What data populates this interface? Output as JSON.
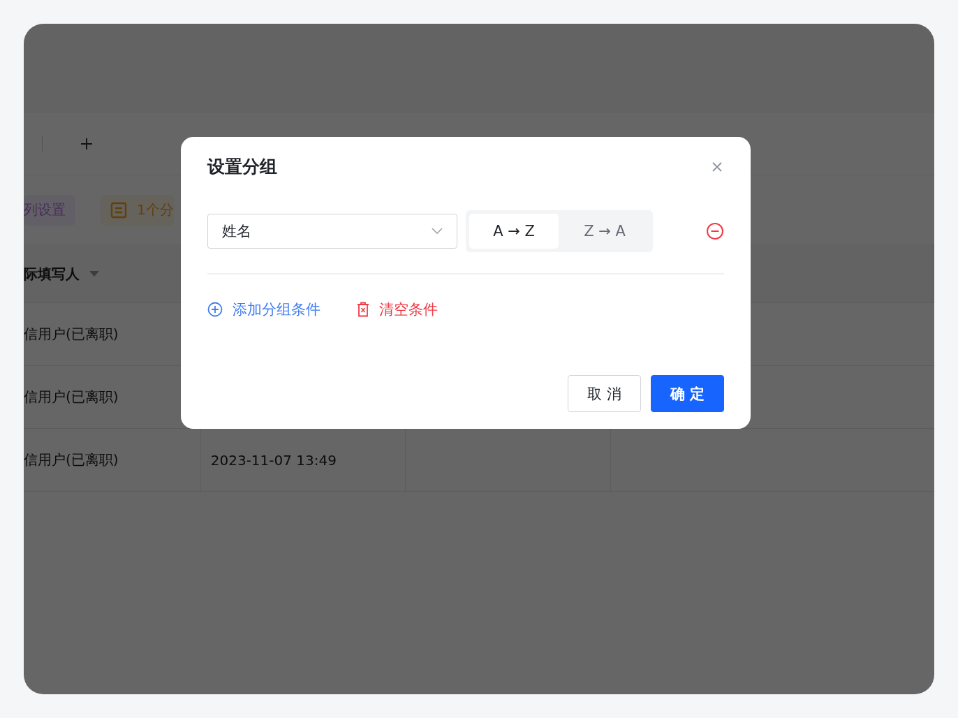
{
  "page": {
    "toolbar": [
      {
        "label": "列设置",
        "kind": "columns"
      },
      {
        "label": "1个分",
        "kind": "group"
      }
    ],
    "table": {
      "columns": [
        "际填写人"
      ],
      "rows": [
        {
          "cells": [
            "信用户(已离职)"
          ]
        },
        {
          "cells": [
            "信用户(已离职)"
          ]
        },
        {
          "cells": [
            "信用户(已离职)",
            "2023-11-07 13:49"
          ]
        }
      ]
    }
  },
  "dialog": {
    "title": "设置分组",
    "field": {
      "value": "姓名"
    },
    "sort_options": [
      {
        "label": "A → Z",
        "selected": true
      },
      {
        "label": "Z → A",
        "selected": false
      }
    ],
    "actions": [
      {
        "label": "添加分组条件",
        "kind": "add"
      },
      {
        "label": "清空条件",
        "kind": "clear"
      }
    ],
    "buttons": [
      {
        "label": "取 消",
        "kind": "secondary"
      },
      {
        "label": "确 定",
        "kind": "primary"
      }
    ]
  }
}
